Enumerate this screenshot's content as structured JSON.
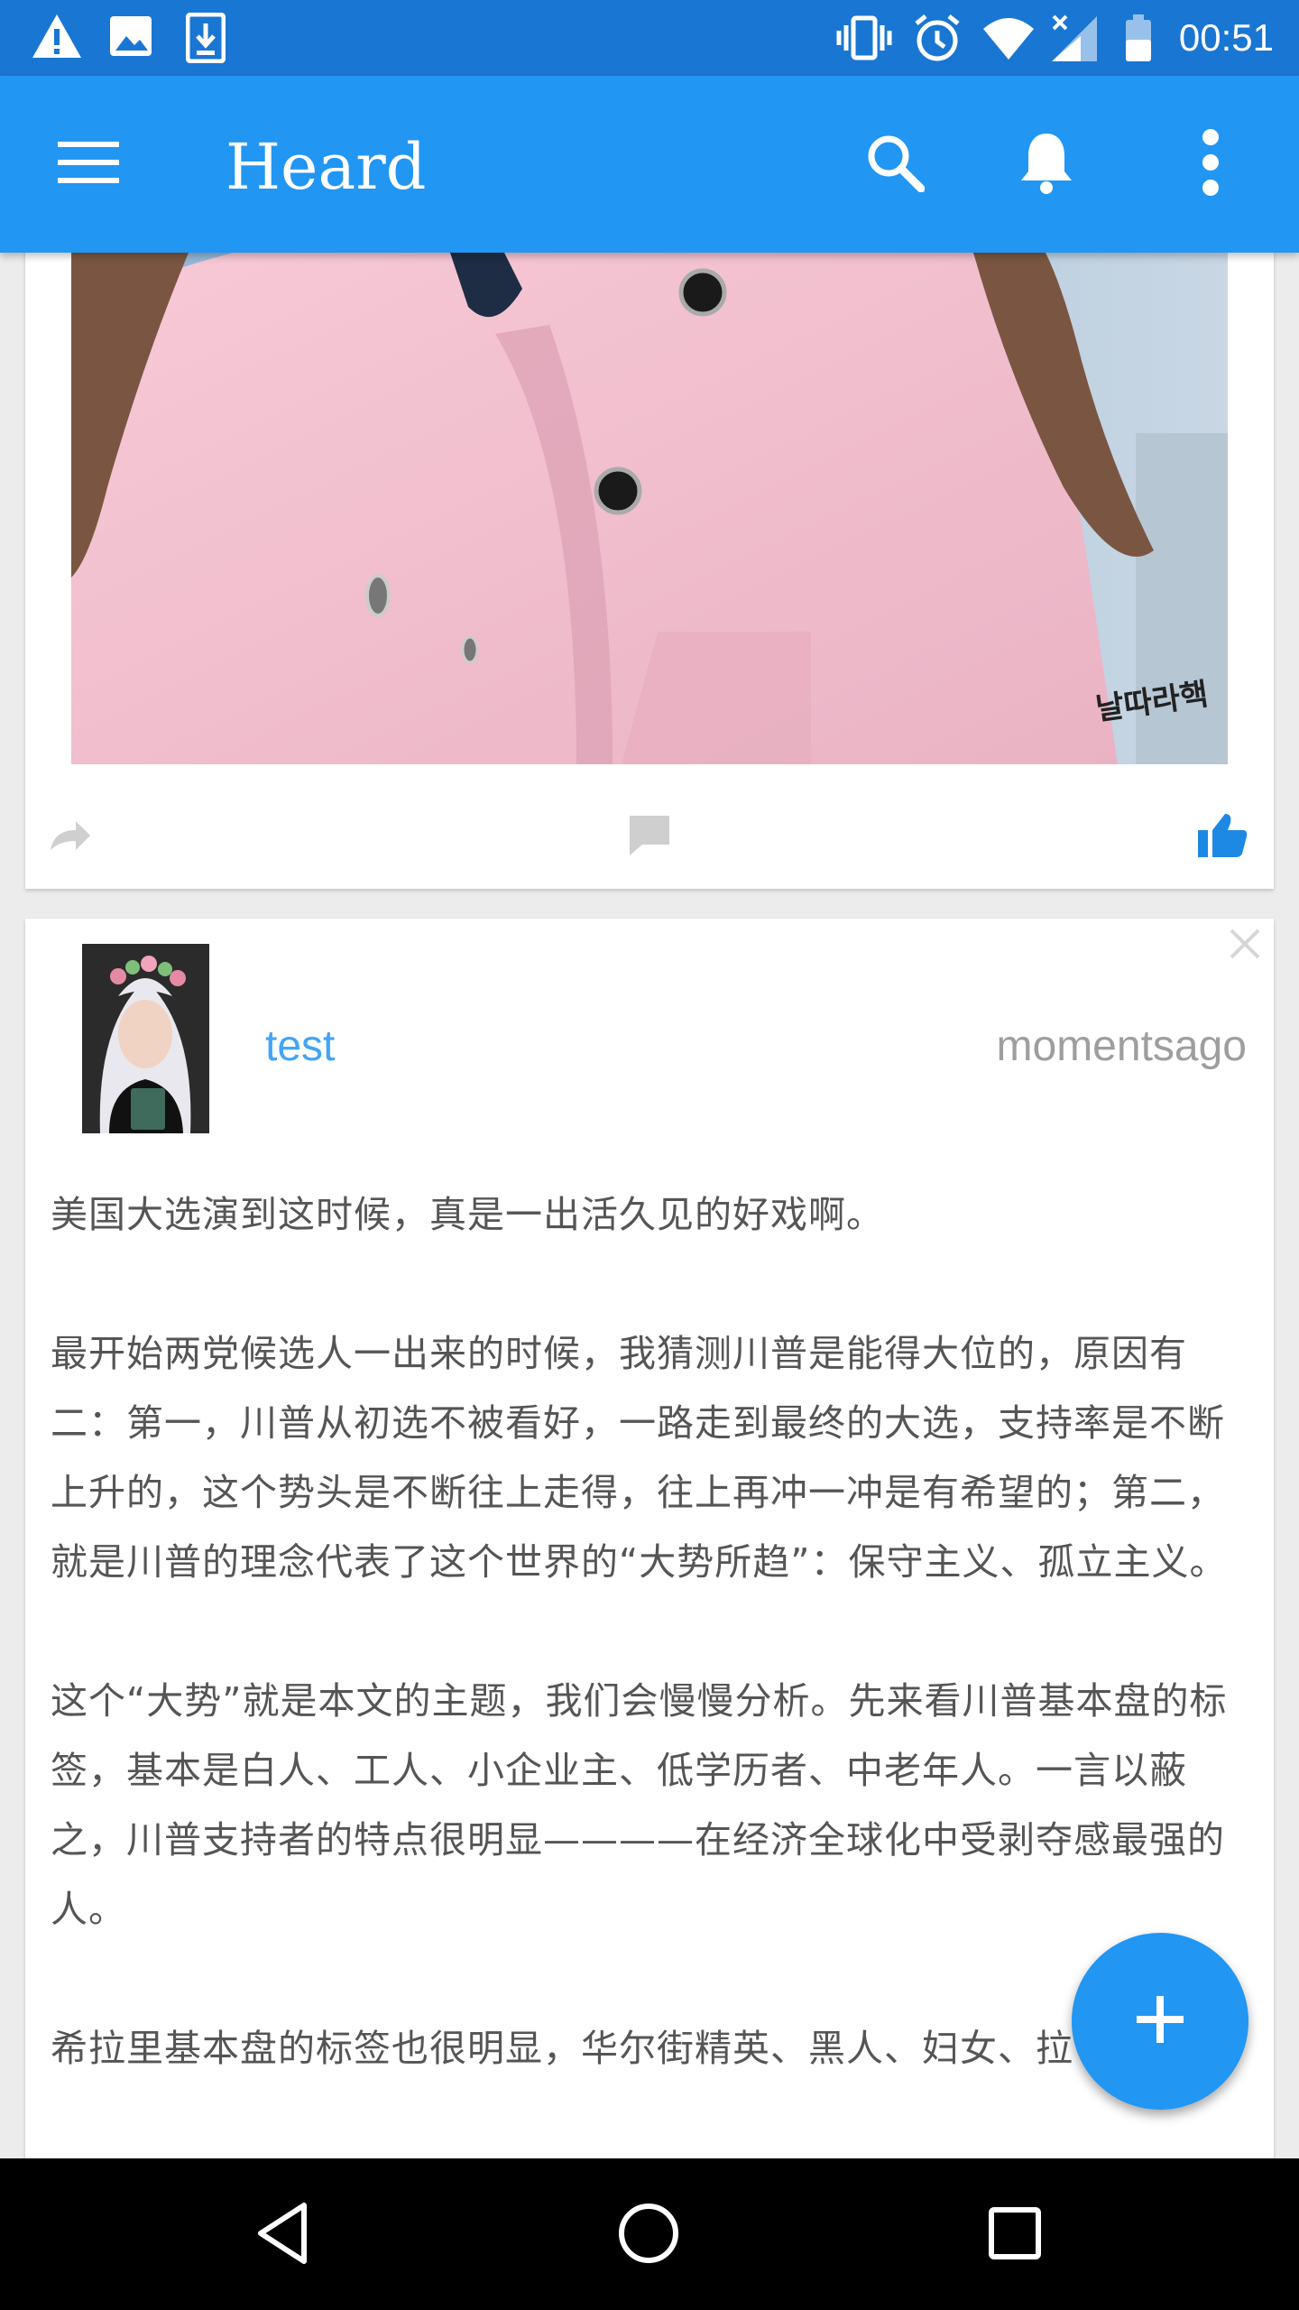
{
  "status_bar": {
    "time": "00:51",
    "left_icons": [
      "warning-icon",
      "image-icon",
      "download-icon"
    ],
    "right_icons": [
      "vibrate-icon",
      "alarm-icon",
      "wifi-icon",
      "signal-icon",
      "battery-icon"
    ]
  },
  "app_bar": {
    "title": "Heard",
    "icons": [
      "menu-icon",
      "search-icon",
      "notifications-icon",
      "more-vert-icon"
    ]
  },
  "first_post": {
    "watermark": "날따라핵",
    "actions": [
      "share-icon",
      "comment-icon",
      "like-icon"
    ]
  },
  "second_post": {
    "username": "test",
    "timestamp": "momentsago",
    "paragraphs": [
      "美国大选演到这时候，真是一出活久见的好戏啊。",
      "最开始两党候选人一出来的时候，我猜测川普是能得大位的，原因有二：第一，川普从初选不被看好，一路走到最终的大选，支持率是不断上升的，这个势头是不断往上走得，往上再冲一冲是有希望的；第二，就是川普的理念代表了这个世界的“大势所趋”：保守主义、孤立主义。",
      "这个“大势”就是本文的主题，我们会慢慢分析。先来看川普基本盘的标签，基本是白人、工人、小企业主、低学历者、中老年人。一言以蔽之，川普支持者的特点很明显————在经济全球化中受剥夺感最强的人。",
      "希拉里基本盘的标签也很明显，华尔街精英、黑人、妇女、拉"
    ]
  },
  "colors": {
    "status_bar": "#1976d2",
    "app_bar": "#2196f3",
    "accent": "#2196f3",
    "username": "#42a5f5"
  },
  "nav_bar": {
    "icons": [
      "back-icon",
      "home-icon",
      "recents-icon"
    ]
  }
}
